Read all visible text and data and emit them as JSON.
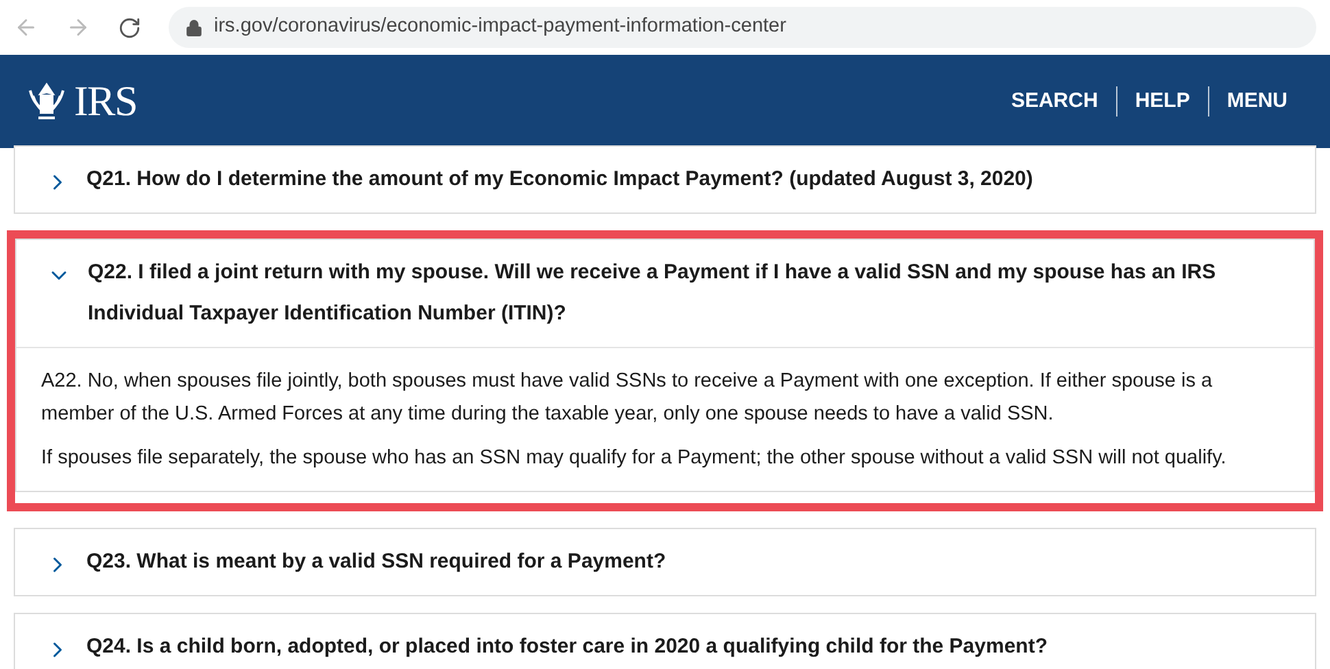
{
  "browser": {
    "url": "irs.gov/coronavirus/economic-impact-payment-information-center"
  },
  "header": {
    "logo_text": "IRS",
    "nav": [
      "SEARCH",
      "HELP",
      "MENU"
    ]
  },
  "faqs": [
    {
      "question": "Q21. How do I determine the amount of my Economic Impact Payment? (updated August 3, 2020)",
      "expanded": false,
      "highlighted": false
    },
    {
      "question": "Q22. I filed a joint return with my spouse. Will we receive a Payment if I have a valid SSN and my spouse has an IRS Individual Taxpayer Identification Number (ITIN)?",
      "expanded": true,
      "highlighted": true,
      "answer": [
        "A22. No, when spouses file jointly, both spouses must have valid SSNs to receive a Payment with one exception. If either spouse is a member of the U.S. Armed Forces at any time during the taxable year, only one spouse needs to have a valid SSN.",
        "If spouses file separately, the spouse who has an SSN may qualify for a Payment; the other spouse without a valid SSN will not qualify."
      ]
    },
    {
      "question": "Q23. What is meant by a valid SSN required for a Payment?",
      "expanded": false,
      "highlighted": false
    },
    {
      "question": "Q24. Is a child born, adopted, or placed into foster care in 2020 a qualifying child for the Payment?",
      "expanded": false,
      "highlighted": false
    }
  ]
}
